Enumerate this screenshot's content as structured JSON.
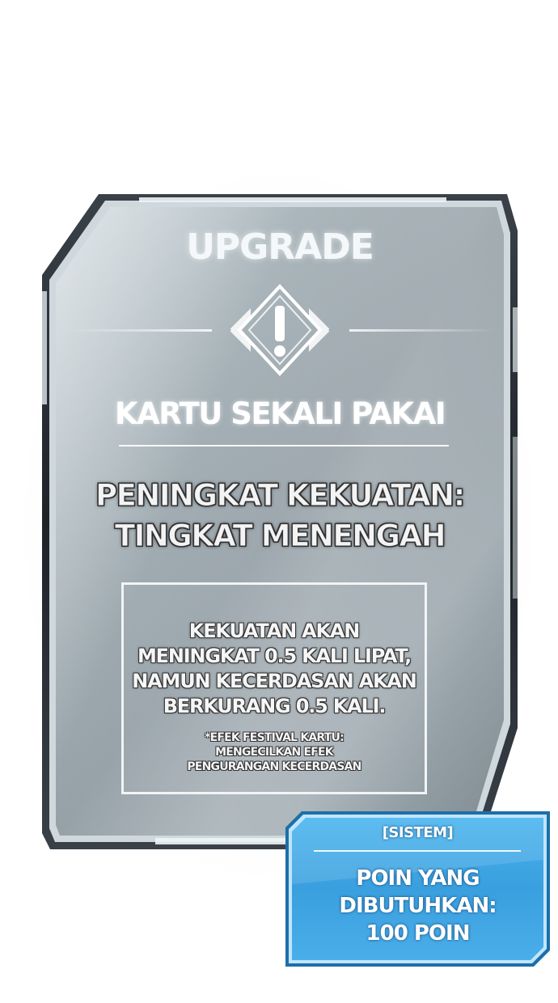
{
  "card": {
    "header": "UPGRADE",
    "icon": "warning-exclamation-icon",
    "type": "KARTU SEKALI PAKAI",
    "name_lines": [
      "PENINGKAT KEKUATAN:",
      "TINGKAT MENENGAH"
    ],
    "description_lines": [
      "KEKUATAN AKAN",
      "MENINGKAT 0.5 KALI LIPAT,",
      "NAMUN KECERDASAN AKAN",
      "BERKURANG 0.5 KALI."
    ],
    "note_lines": [
      "*EFEK FESTIVAL KARTU:",
      "MENGECILKAN EFEK",
      "PENGURANGAN KECERDASAN"
    ]
  },
  "system": {
    "label": "[SISTEM]",
    "text_lines": [
      "POIN YANG",
      "DIBUTUHKAN:",
      "100 POIN"
    ]
  },
  "colors": {
    "card_metal": "#9aa6ac",
    "card_dark_frame": "#2b3036",
    "system_blue": "#3aa2e2",
    "system_border": "#bfe6ff"
  }
}
